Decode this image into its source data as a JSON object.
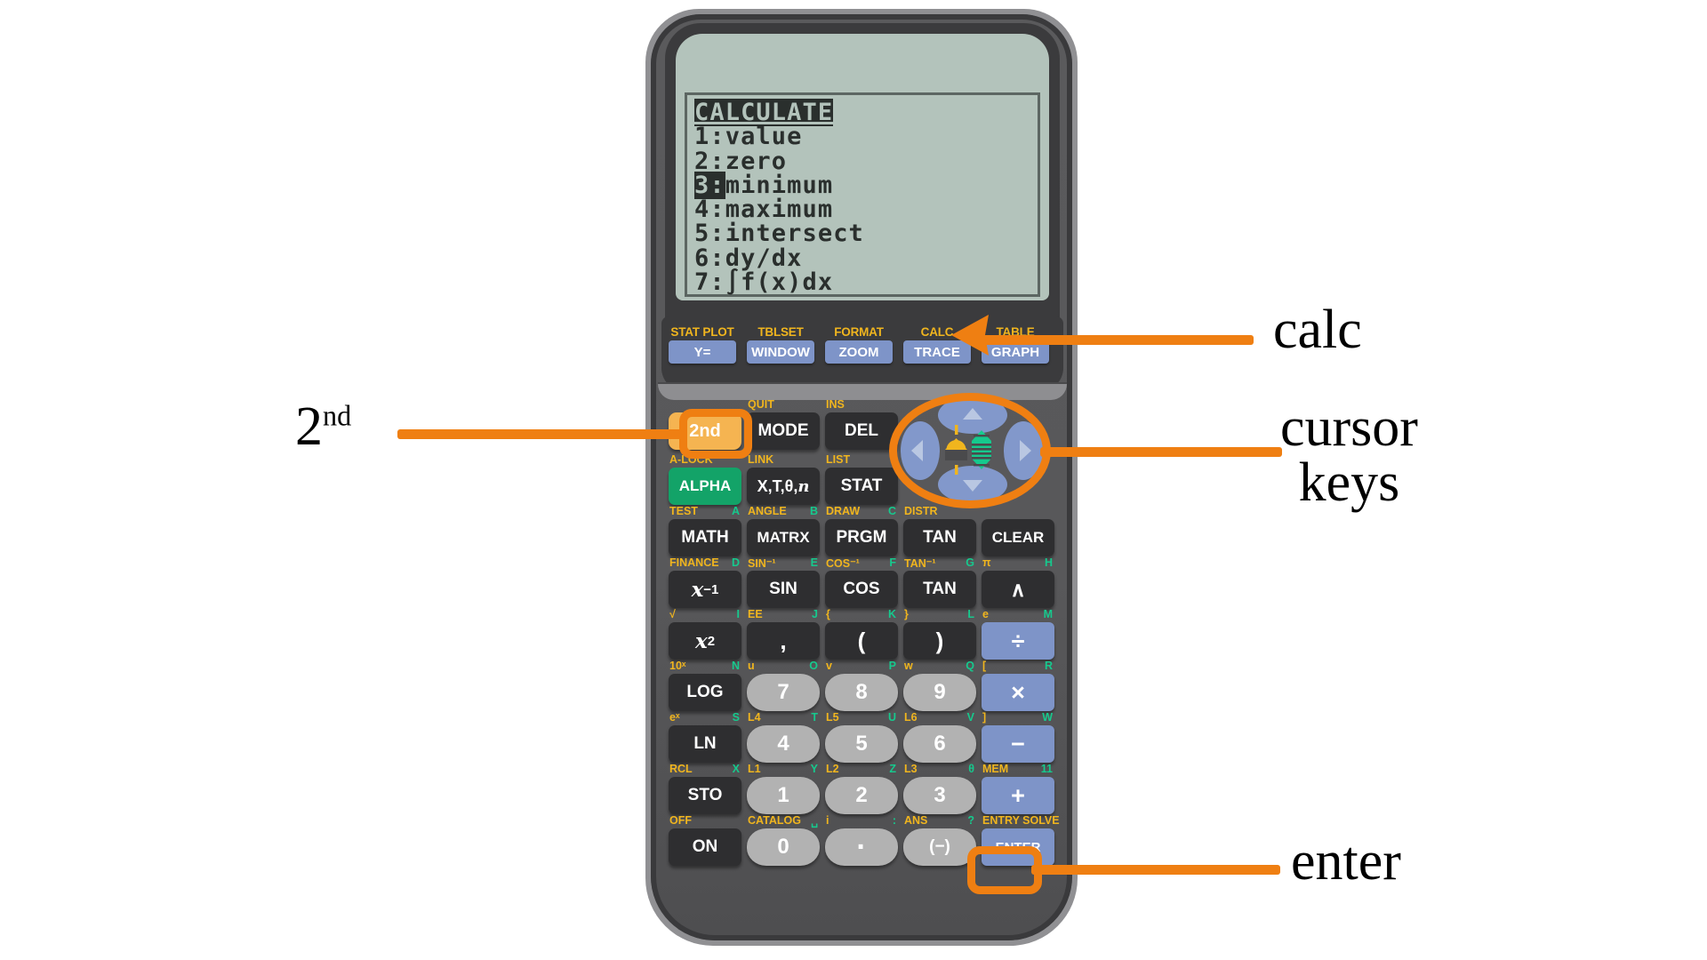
{
  "device": {
    "name": "graphing-calculator",
    "body_color": "#58585a",
    "accent_color": "#ef7f12"
  },
  "screen": {
    "title": "CALCULATE",
    "lines": [
      {
        "text": "1:value",
        "inverse_prefix": ""
      },
      {
        "text": "2:zero",
        "inverse_prefix": ""
      },
      {
        "text": "3:minimum",
        "inverse_prefix": "3:"
      },
      {
        "text": "4:maximum",
        "inverse_prefix": ""
      },
      {
        "text": "5:intersect",
        "inverse_prefix": ""
      },
      {
        "text": "6:dy/dx",
        "inverse_prefix": ""
      },
      {
        "text": "7:∫f(x)dx",
        "inverse_prefix": ""
      }
    ],
    "selected_index": 2,
    "lcd_bg": "#b3c3bb",
    "lcd_fg": "#2a2f2d"
  },
  "function_row": [
    {
      "second": "STAT PLOT",
      "primary": "Y="
    },
    {
      "second": "TBLSET",
      "primary": "WINDOW"
    },
    {
      "second": "FORMAT",
      "primary": "ZOOM"
    },
    {
      "second": "CALC",
      "primary": "TRACE"
    },
    {
      "second": "TABLE",
      "primary": "GRAPH"
    }
  ],
  "keypad": {
    "rows": [
      [
        {
          "label": "2nd",
          "second": "",
          "alpha": "",
          "style": "k-2nd"
        },
        {
          "label": "MODE",
          "second": "QUIT",
          "alpha": "",
          "style": "k-dark"
        },
        {
          "label": "DEL",
          "second": "INS",
          "alpha": "",
          "style": "k-dark"
        }
      ],
      [
        {
          "label": "ALPHA",
          "second": "A-LOCK",
          "alpha": "",
          "style": "k-alpha"
        },
        {
          "label": "X,T,θ,n",
          "second": "LINK",
          "alpha": "",
          "style": "k-dark"
        },
        {
          "label": "STAT",
          "second": "LIST",
          "alpha": "",
          "style": "k-dark"
        }
      ],
      [
        {
          "label": "MATH",
          "second": "TEST",
          "alpha": "A",
          "style": "k-dark"
        },
        {
          "label": "MATRX",
          "second": "ANGLE",
          "alpha": "B",
          "style": "k-dark"
        },
        {
          "label": "PRGM",
          "second": "DRAW",
          "alpha": "C",
          "style": "k-dark"
        },
        {
          "label": "TAN",
          "second": "DISTR",
          "alpha": "",
          "style": "k-dark"
        },
        {
          "label": "CLEAR",
          "second": "",
          "alpha": "",
          "style": "k-dark"
        }
      ],
      [
        {
          "label": "x⁻¹",
          "second": "FINANCE",
          "alpha": "D",
          "style": "k-dark"
        },
        {
          "label": "SIN",
          "second": "SIN⁻¹",
          "alpha": "E",
          "style": "k-dark"
        },
        {
          "label": "COS",
          "second": "COS⁻¹",
          "alpha": "F",
          "style": "k-dark"
        },
        {
          "label": "TAN",
          "second": "TAN⁻¹",
          "alpha": "G",
          "style": "k-dark"
        },
        {
          "label": "^",
          "second": "π",
          "alpha": "H",
          "style": "k-dark"
        }
      ],
      [
        {
          "label": "x²",
          "second": "√",
          "alpha": "I",
          "style": "k-dark"
        },
        {
          "label": ",",
          "second": "EE",
          "alpha": "J",
          "style": "k-dark"
        },
        {
          "label": "(",
          "second": "{",
          "alpha": "K",
          "style": "k-dark"
        },
        {
          "label": ")",
          "second": "}",
          "alpha": "L",
          "style": "k-dark"
        },
        {
          "label": "÷",
          "second": "e",
          "alpha": "M",
          "style": "k-blue"
        }
      ],
      [
        {
          "label": "LOG",
          "second": "10ˣ",
          "alpha": "N",
          "style": "k-dark"
        },
        {
          "label": "7",
          "second": "u",
          "alpha": "O",
          "style": "k-gray"
        },
        {
          "label": "8",
          "second": "v",
          "alpha": "P",
          "style": "k-gray"
        },
        {
          "label": "9",
          "second": "w",
          "alpha": "Q",
          "style": "k-gray"
        },
        {
          "label": "×",
          "second": "[",
          "alpha": "R",
          "style": "k-blue"
        }
      ],
      [
        {
          "label": "LN",
          "second": "eˣ",
          "alpha": "S",
          "style": "k-dark"
        },
        {
          "label": "4",
          "second": "L4",
          "alpha": "T",
          "style": "k-gray"
        },
        {
          "label": "5",
          "second": "L5",
          "alpha": "U",
          "style": "k-gray"
        },
        {
          "label": "6",
          "second": "L6",
          "alpha": "V",
          "style": "k-gray"
        },
        {
          "label": "−",
          "second": "]",
          "alpha": "W",
          "style": "k-blue"
        }
      ],
      [
        {
          "label": "STO",
          "second": "RCL",
          "alpha": "X",
          "style": "k-dark"
        },
        {
          "label": "1",
          "second": "L1",
          "alpha": "Y",
          "style": "k-gray"
        },
        {
          "label": "2",
          "second": "L2",
          "alpha": "Z",
          "style": "k-gray"
        },
        {
          "label": "3",
          "second": "L3",
          "alpha": "θ",
          "style": "k-gray"
        },
        {
          "label": "+",
          "second": "MEM",
          "alpha": "11",
          "style": "k-blue"
        }
      ],
      [
        {
          "label": "ON",
          "second": "OFF",
          "alpha": "",
          "style": "k-dark"
        },
        {
          "label": "0",
          "second": "CATALOG",
          "alpha": "␣",
          "style": "k-gray"
        },
        {
          "label": "·",
          "second": "i",
          "alpha": ":",
          "style": "k-gray"
        },
        {
          "label": "(−)",
          "second": "ANS",
          "alpha": "?",
          "style": "k-gray"
        },
        {
          "label": "ENTER",
          "second": "ENTRY SOLVE",
          "alpha": "",
          "style": "k-blue"
        }
      ]
    ]
  },
  "cursor_pad": {
    "up": "up-arrow",
    "down": "down-arrow",
    "left": "left-arrow",
    "right": "right-arrow",
    "center_icons": [
      "contrast-dim-icon",
      "contrast-bright-icon"
    ]
  },
  "annotations": [
    {
      "id": "calc",
      "text": "calc",
      "lines": [
        "calc"
      ]
    },
    {
      "id": "second",
      "text": "2nd",
      "lines": [
        "2nd"
      ]
    },
    {
      "id": "cursor-keys",
      "text": "cursor keys",
      "lines": [
        "cursor",
        "keys"
      ]
    },
    {
      "id": "enter",
      "text": "enter",
      "lines": [
        "enter"
      ]
    }
  ]
}
